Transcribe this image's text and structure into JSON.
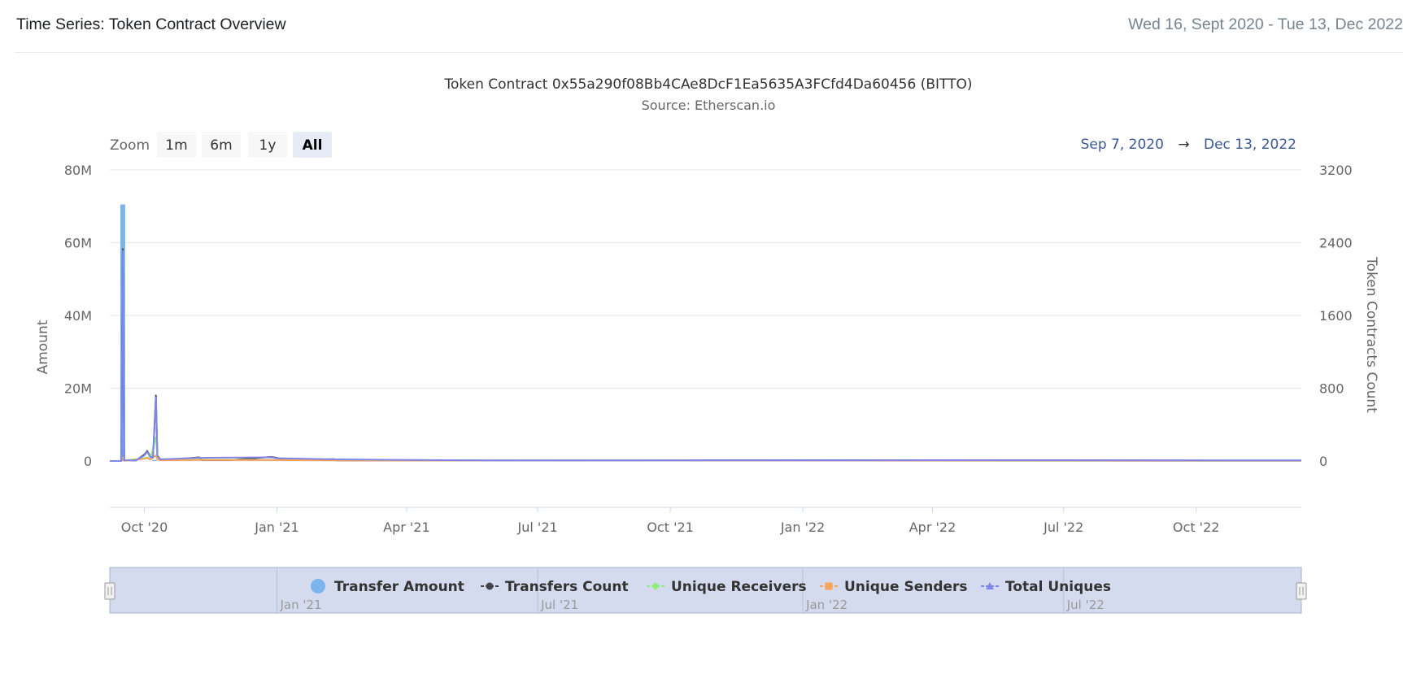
{
  "header": {
    "title": "Time Series: Token Contract Overview",
    "date_range": "Wed 16, Sept 2020 - Tue 13, Dec 2022"
  },
  "chart": {
    "zoom_label": "Zoom",
    "zoom_buttons": [
      "1m",
      "6m",
      "1y",
      "All"
    ],
    "active_zoom": "All",
    "range_from": "Sep 7, 2020",
    "range_arrow": "→",
    "range_to": "Dec 13, 2022"
  },
  "colors": {
    "transfer_amount": "#7cb5ec",
    "transfers_count": "#434348",
    "unique_receivers": "#90ed7d",
    "unique_senders": "#f7a35c",
    "total_uniques": "#8085e9",
    "navigator_fill": "#d5dbee",
    "range_text": "#3b5998"
  },
  "chart_data": {
    "type": "line",
    "title": "Token Contract 0x55a290f08Bb4CAe8DcF1Ea5635A3FCfd4Da60456 (BITTO)",
    "subtitle": "Source: Etherscan.io",
    "ylabel_left": "Amount",
    "ylabel_right": "Token Contracts Count",
    "yleft_ticks": [
      "0",
      "20M",
      "40M",
      "60M",
      "80M"
    ],
    "yleft_lim": [
      0,
      80000000
    ],
    "yright_ticks": [
      "0",
      "800",
      "1600",
      "2400",
      "3200"
    ],
    "yright_lim": [
      0,
      3200
    ],
    "x_range": [
      "2020-09-07",
      "2022-12-13"
    ],
    "x_ticks": [
      {
        "date": "2020-10-01",
        "label": "Oct '20"
      },
      {
        "date": "2021-01-01",
        "label": "Jan '21"
      },
      {
        "date": "2021-04-01",
        "label": "Apr '21"
      },
      {
        "date": "2021-07-01",
        "label": "Jul '21"
      },
      {
        "date": "2021-10-01",
        "label": "Oct '21"
      },
      {
        "date": "2022-01-01",
        "label": "Jan '22"
      },
      {
        "date": "2022-04-01",
        "label": "Apr '22"
      },
      {
        "date": "2022-07-01",
        "label": "Jul '22"
      },
      {
        "date": "2022-10-01",
        "label": "Oct '22"
      }
    ],
    "navigator_ticks": [
      {
        "date": "2021-01-01",
        "label": "Jan '21"
      },
      {
        "date": "2021-07-01",
        "label": "Jul '21"
      },
      {
        "date": "2022-01-01",
        "label": "Jan '22"
      },
      {
        "date": "2022-07-01",
        "label": "Jul '22"
      }
    ],
    "grid": true,
    "legend_position": "bottom-center",
    "series": [
      {
        "name": "Transfer Amount",
        "axis": "left",
        "kind": "column",
        "color": "#7cb5ec",
        "points": [
          [
            "2020-09-16",
            70500000
          ],
          [
            "2020-10-08",
            300000
          ]
        ]
      },
      {
        "name": "Transfers Count",
        "axis": "right",
        "kind": "line",
        "color": "#434348",
        "points": [
          [
            "2020-09-07",
            0
          ],
          [
            "2020-09-15",
            0
          ],
          [
            "2020-09-16",
            2330
          ],
          [
            "2020-09-17",
            10
          ],
          [
            "2020-09-25",
            5
          ],
          [
            "2020-10-01",
            70
          ],
          [
            "2020-10-03",
            110
          ],
          [
            "2020-10-05",
            50
          ],
          [
            "2020-10-07",
            40
          ],
          [
            "2020-10-09",
            720
          ],
          [
            "2020-10-10",
            60
          ],
          [
            "2020-10-12",
            20
          ],
          [
            "2020-10-20",
            15
          ],
          [
            "2020-11-08",
            40
          ],
          [
            "2020-11-10",
            10
          ],
          [
            "2020-11-30",
            10
          ],
          [
            "2020-12-28",
            45
          ],
          [
            "2021-01-01",
            35
          ],
          [
            "2021-01-05",
            10
          ],
          [
            "2021-02-10",
            20
          ],
          [
            "2021-02-12",
            5
          ],
          [
            "2021-06-01",
            5
          ],
          [
            "2021-11-01",
            8
          ],
          [
            "2022-06-01",
            8
          ],
          [
            "2022-12-13",
            5
          ]
        ]
      },
      {
        "name": "Unique Receivers",
        "axis": "right",
        "kind": "line",
        "color": "#90ed7d",
        "points": [
          [
            "2020-09-07",
            0
          ],
          [
            "2020-09-15",
            0
          ],
          [
            "2020-09-16",
            40
          ],
          [
            "2020-09-17",
            5
          ],
          [
            "2020-10-01",
            30
          ],
          [
            "2020-10-03",
            40
          ],
          [
            "2020-10-05",
            20
          ],
          [
            "2020-10-09",
            260
          ],
          [
            "2020-10-10",
            30
          ],
          [
            "2020-10-12",
            10
          ],
          [
            "2020-11-08",
            15
          ],
          [
            "2021-01-01",
            12
          ],
          [
            "2021-02-10",
            8
          ],
          [
            "2022-12-13",
            2
          ]
        ]
      },
      {
        "name": "Unique Senders",
        "axis": "right",
        "kind": "line",
        "color": "#f7a35c",
        "points": [
          [
            "2020-09-07",
            0
          ],
          [
            "2020-09-15",
            0
          ],
          [
            "2020-09-16",
            20
          ],
          [
            "2020-09-17",
            3
          ],
          [
            "2020-10-01",
            25
          ],
          [
            "2020-10-03",
            35
          ],
          [
            "2020-10-05",
            15
          ],
          [
            "2020-10-09",
            60
          ],
          [
            "2020-10-10",
            20
          ],
          [
            "2020-10-12",
            8
          ],
          [
            "2020-11-08",
            12
          ],
          [
            "2021-01-01",
            10
          ],
          [
            "2021-02-10",
            6
          ],
          [
            "2022-12-13",
            2
          ]
        ]
      },
      {
        "name": "Total Uniques",
        "axis": "right",
        "kind": "line",
        "color": "#8085e9",
        "points": [
          [
            "2020-09-07",
            0
          ],
          [
            "2020-09-15",
            0
          ],
          [
            "2020-09-16",
            2310
          ],
          [
            "2020-09-17",
            8
          ],
          [
            "2020-09-25",
            5
          ],
          [
            "2020-10-01",
            60
          ],
          [
            "2020-10-03",
            100
          ],
          [
            "2020-10-05",
            45
          ],
          [
            "2020-10-07",
            35
          ],
          [
            "2020-10-09",
            700
          ],
          [
            "2020-10-10",
            55
          ],
          [
            "2020-10-12",
            18
          ],
          [
            "2020-11-08",
            35
          ],
          [
            "2020-12-28",
            40
          ],
          [
            "2021-01-01",
            30
          ],
          [
            "2021-02-10",
            18
          ],
          [
            "2021-06-01",
            5
          ],
          [
            "2021-11-01",
            6
          ],
          [
            "2022-05-20",
            8
          ],
          [
            "2022-12-13",
            5
          ]
        ]
      }
    ]
  }
}
